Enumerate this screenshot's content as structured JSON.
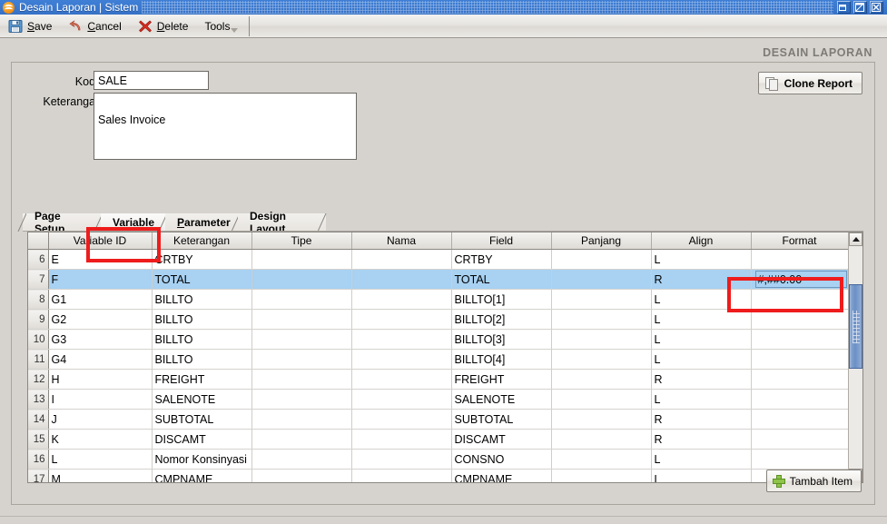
{
  "window": {
    "title": "Desain Laporan | Sistem",
    "app_icon": "orange-round-icon",
    "buttons": [
      {
        "name": "minimize-button",
        "icon": "minimize-icon"
      },
      {
        "name": "maximize-button",
        "icon": "maximize-icon"
      },
      {
        "name": "close-button",
        "icon": "close-icon"
      }
    ]
  },
  "toolbar": {
    "items": [
      {
        "icon": "save-disk-icon",
        "label": "Save",
        "mnemonic": "S"
      },
      {
        "icon": "undo-arrow-icon",
        "label": "Cancel",
        "mnemonic": "C"
      },
      {
        "icon": "delete-x-icon",
        "label": "Delete",
        "mnemonic": "D"
      },
      {
        "icon": "tools-icon",
        "label": "Tools",
        "mnemonic": ""
      }
    ]
  },
  "page": {
    "title": "DESAIN LAPORAN"
  },
  "form": {
    "kode_label": "Kode",
    "kode_value": "SALE",
    "kode_placeholder": "",
    "keterangan_label": "Keterangan",
    "keterangan_value": "Sales Invoice",
    "keterangan_placeholder": "",
    "clone_button": "Clone Report",
    "clone_icon": "copy-pages-icon"
  },
  "tabs": [
    {
      "label": "Page Setup",
      "mnemonic": "",
      "active": false
    },
    {
      "label": "Variable",
      "mnemonic": "V",
      "active": true
    },
    {
      "label": "Parameter",
      "mnemonic": "P",
      "active": false
    },
    {
      "label": "Design Layout",
      "mnemonic": "",
      "active": false
    }
  ],
  "grid": {
    "columns": [
      {
        "key": "rownum",
        "label": ""
      },
      {
        "key": "variable_id",
        "label": "Variable ID"
      },
      {
        "key": "keterangan",
        "label": "Keterangan"
      },
      {
        "key": "tipe",
        "label": "Tipe"
      },
      {
        "key": "nama",
        "label": "Nama"
      },
      {
        "key": "field",
        "label": "Field"
      },
      {
        "key": "panjang",
        "label": "Panjang"
      },
      {
        "key": "align",
        "label": "Align"
      },
      {
        "key": "format",
        "label": "Format"
      }
    ],
    "rows": [
      {
        "rownum": "6",
        "variable_id": "E",
        "keterangan": "CRTBY",
        "tipe": "",
        "nama": "",
        "field": "CRTBY",
        "panjang": "",
        "align": "L",
        "format": "",
        "selected": false,
        "format_editing": false
      },
      {
        "rownum": "7",
        "variable_id": "F",
        "keterangan": "TOTAL",
        "tipe": "",
        "nama": "",
        "field": "TOTAL",
        "panjang": "",
        "align": "R",
        "format": "#,##0.00",
        "selected": true,
        "format_editing": true
      },
      {
        "rownum": "8",
        "variable_id": "G1",
        "keterangan": "BILLTO",
        "tipe": "",
        "nama": "",
        "field": "BILLTO[1]",
        "panjang": "",
        "align": "L",
        "format": "",
        "selected": false,
        "format_editing": false
      },
      {
        "rownum": "9",
        "variable_id": "G2",
        "keterangan": "BILLTO",
        "tipe": "",
        "nama": "",
        "field": "BILLTO[2]",
        "panjang": "",
        "align": "L",
        "format": "",
        "selected": false,
        "format_editing": false
      },
      {
        "rownum": "10",
        "variable_id": "G3",
        "keterangan": "BILLTO",
        "tipe": "",
        "nama": "",
        "field": "BILLTO[3]",
        "panjang": "",
        "align": "L",
        "format": "",
        "selected": false,
        "format_editing": false
      },
      {
        "rownum": "11",
        "variable_id": "G4",
        "keterangan": "BILLTO",
        "tipe": "",
        "nama": "",
        "field": "BILLTO[4]",
        "panjang": "",
        "align": "L",
        "format": "",
        "selected": false,
        "format_editing": false
      },
      {
        "rownum": "12",
        "variable_id": "H",
        "keterangan": "FREIGHT",
        "tipe": "",
        "nama": "",
        "field": "FREIGHT",
        "panjang": "",
        "align": "R",
        "format": "",
        "selected": false,
        "format_editing": false
      },
      {
        "rownum": "13",
        "variable_id": "I",
        "keterangan": "SALENOTE",
        "tipe": "",
        "nama": "",
        "field": "SALENOTE",
        "panjang": "",
        "align": "L",
        "format": "",
        "selected": false,
        "format_editing": false
      },
      {
        "rownum": "14",
        "variable_id": "J",
        "keterangan": "SUBTOTAL",
        "tipe": "",
        "nama": "",
        "field": "SUBTOTAL",
        "panjang": "",
        "align": "R",
        "format": "",
        "selected": false,
        "format_editing": false
      },
      {
        "rownum": "15",
        "variable_id": "K",
        "keterangan": "DISCAMT",
        "tipe": "",
        "nama": "",
        "field": "DISCAMT",
        "panjang": "",
        "align": "R",
        "format": "",
        "selected": false,
        "format_editing": false
      },
      {
        "rownum": "16",
        "variable_id": "L",
        "keterangan": "Nomor Konsinyasi",
        "tipe": "",
        "nama": "",
        "field": "CONSNO",
        "panjang": "",
        "align": "L",
        "format": "",
        "selected": false,
        "format_editing": false
      },
      {
        "rownum": "17",
        "variable_id": "M",
        "keterangan": "CMPNAME",
        "tipe": "",
        "nama": "",
        "field": "CMPNAME",
        "panjang": "",
        "align": "L",
        "format": "",
        "selected": false,
        "format_editing": false
      }
    ],
    "scrollbar": {
      "up_icon": "scroll-up-arrow-icon",
      "down_icon": "scroll-down-arrow-icon"
    }
  },
  "footer": {
    "add_item_button": "Tambah Item",
    "add_item_icon": "plus-icon"
  },
  "colors": {
    "selection_blue": "#a8d1f2",
    "annotation_red": "#ee1c1c",
    "title_gray": "#7e7b76",
    "window_chrome_blue": "#3b79cf",
    "panel_gray": "#d6d3ce"
  }
}
